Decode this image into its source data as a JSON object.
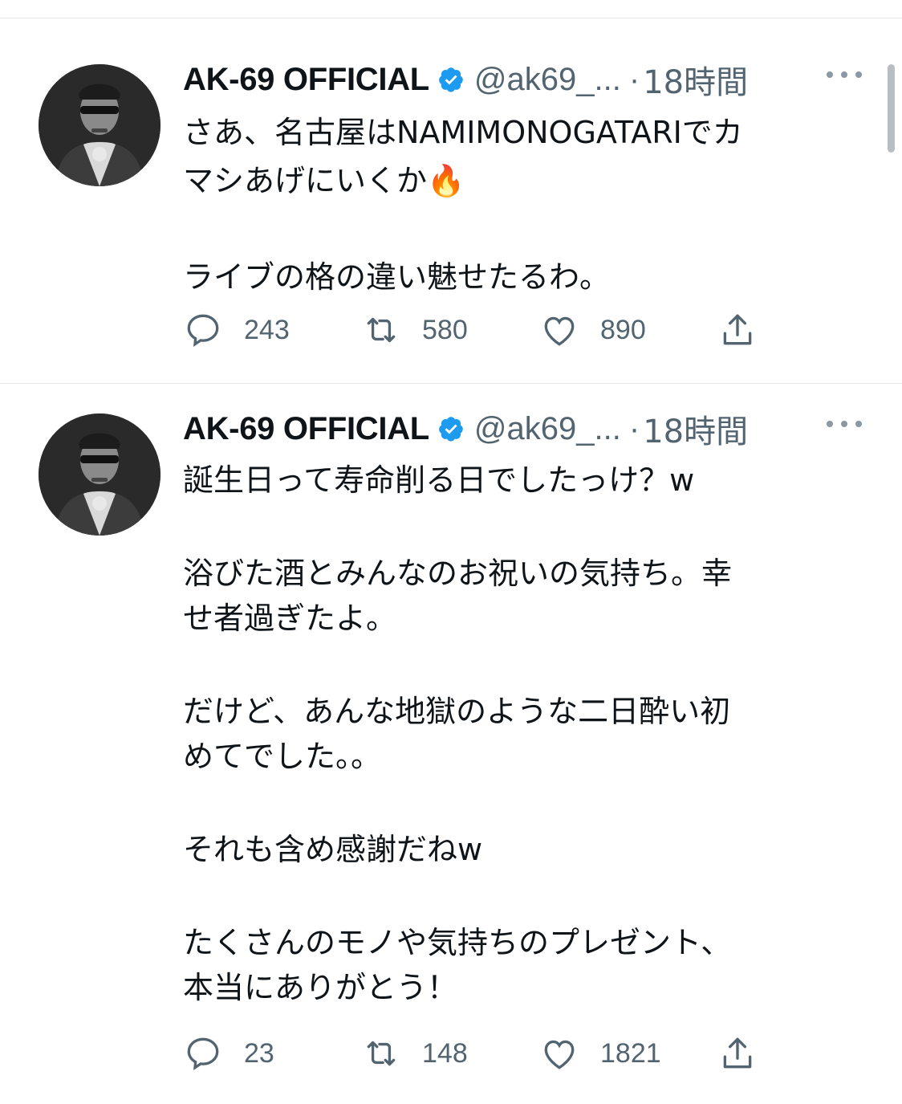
{
  "colors": {
    "text": "#0f1419",
    "secondary": "#536471",
    "verified": "#1d9bf0",
    "divider": "#e6e9ec"
  },
  "tweets": [
    {
      "author_name": "AK-69 OFFICIAL",
      "handle": "@ak69_...",
      "separator": "·",
      "time": "18時間",
      "verified_icon": "verified-badge-icon",
      "body_lines": [
        "さあ、名古屋はNAMIMONOGATARIでカ",
        "マシあげにいくか🔥",
        "",
        "ライブの格の違い魅せたるわ。"
      ],
      "replies": "243",
      "retweets": "580",
      "likes": "890"
    },
    {
      "author_name": "AK-69 OFFICIAL",
      "handle": "@ak69_...",
      "separator": "·",
      "time": "18時間",
      "verified_icon": "verified-badge-icon",
      "body_lines": [
        "誕生日って寿命削る日でしたっけ？w",
        "",
        "浴びた酒とみんなのお祝いの気持ち。幸",
        "せ者過ぎたよ。",
        "",
        "だけど、あんな地獄のような二日酔い初",
        "めてでした。。",
        "",
        "それも含め感謝だねw",
        "",
        "たくさんのモノや気持ちのプレゼント、",
        "本当にありがとう！"
      ],
      "replies": "23",
      "retweets": "148",
      "likes": "1821"
    }
  ]
}
